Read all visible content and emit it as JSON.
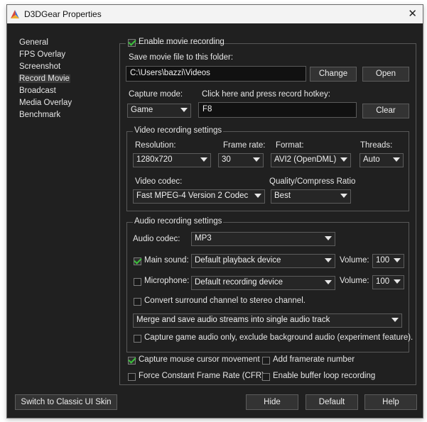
{
  "window": {
    "title": "D3DGear Properties"
  },
  "sidebar": {
    "items": [
      "General",
      "FPS Overlay",
      "Screenshot",
      "Record Movie",
      "Broadcast",
      "Media Overlay",
      "Benchmark"
    ],
    "selected": "Record Movie"
  },
  "record": {
    "enable_label": "Enable movie recording",
    "enabled": true,
    "folder_label": "Save movie file to this folder:",
    "folder_value": "C:\\Users\\bazzi\\Videos",
    "change_btn": "Change",
    "open_btn": "Open",
    "capture_mode_label": "Capture mode:",
    "capture_mode_value": "Game",
    "hotkey_label": "Click here and press record hotkey:",
    "hotkey_value": "F8",
    "clear_btn": "Clear"
  },
  "video": {
    "group_title": "Video recording settings",
    "resolution_label": "Resolution:",
    "resolution_value": "1280x720",
    "framerate_label": "Frame rate:",
    "framerate_value": "30",
    "format_label": "Format:",
    "format_value": "AVI2 (OpenDML)",
    "threads_label": "Threads:",
    "threads_value": "Auto",
    "codec_label": "Video codec:",
    "codec_value": "Fast MPEG-4 Version 2 Codec",
    "quality_label": "Quality/Compress Ratio",
    "quality_value": "Best"
  },
  "audio": {
    "group_title": "Audio recording settings",
    "codec_label": "Audio codec:",
    "codec_value": "MP3",
    "main_label": "Main sound:",
    "main_checked": true,
    "main_device": "Default playback device",
    "volume_label": "Volume:",
    "main_volume": "100",
    "mic_label": "Microphone:",
    "mic_checked": false,
    "mic_device": "Default recording device",
    "mic_volume": "100",
    "surround_label": "Convert surround channel to stereo channel.",
    "merge_value": "Merge and save audio streams into single audio track",
    "game_only_label": "Capture game audio only, exclude background audio (experiment feature)."
  },
  "options": {
    "mouse_label": "Capture mouse cursor movement",
    "mouse_checked": true,
    "framerate_label": "Add framerate number",
    "cfr_label": "Force Constant Frame Rate (CFR)",
    "loop_label": "Enable buffer loop recording"
  },
  "footer": {
    "classic_btn": "Switch to Classic UI Skin",
    "hide_btn": "Hide",
    "default_btn": "Default",
    "help_btn": "Help"
  },
  "colors": {
    "background": "#202020",
    "check": "#3cc23c"
  }
}
